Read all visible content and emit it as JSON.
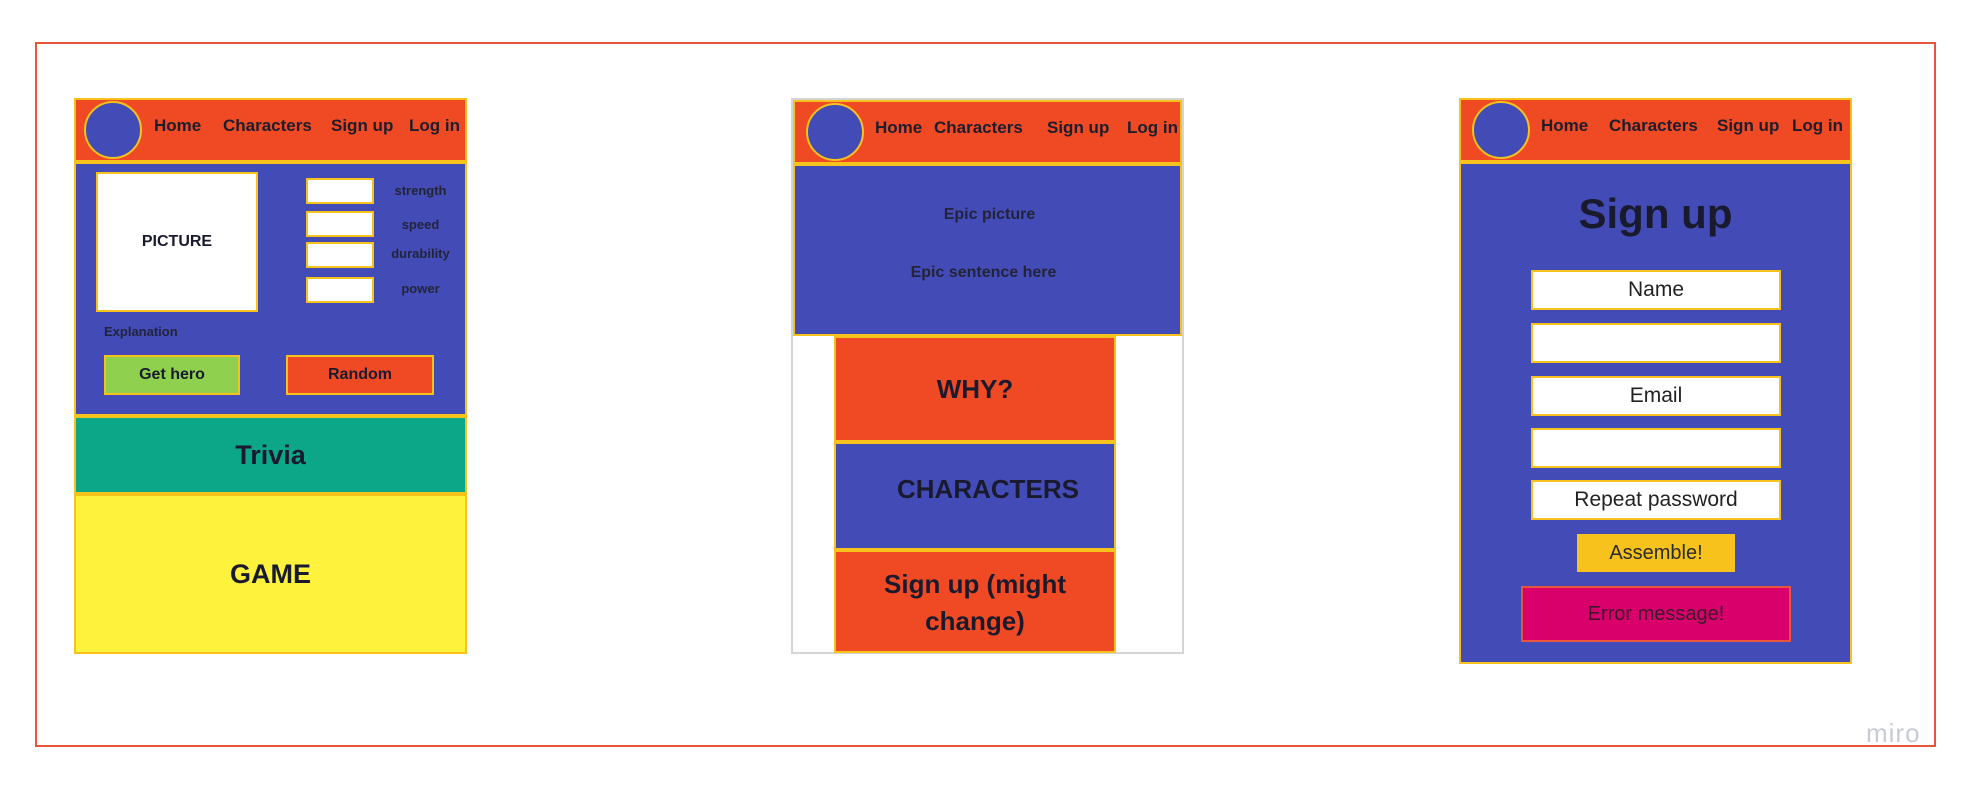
{
  "nav": {
    "home": "Home",
    "characters": "Characters",
    "signup": "Sign up",
    "login": "Log in"
  },
  "hero_page": {
    "picture": "PICTURE",
    "stats": [
      "strength",
      "speed",
      "durability",
      "power"
    ],
    "explanation": "Explanation",
    "get_hero": "Get hero",
    "random": "Random",
    "trivia": "Trivia",
    "game": "GAME"
  },
  "home_page": {
    "epic_picture": "Epic picture",
    "epic_sentence": "Epic sentence here",
    "why": "WHY?",
    "characters": "CHARACTERS",
    "signup_line1": "Sign up (might",
    "signup_line2": "change)"
  },
  "signup_page": {
    "title": "Sign up",
    "name_placeholder": "Name",
    "field2": "",
    "email_placeholder": "Email",
    "field4": "",
    "repeat_password": "Repeat password",
    "assemble": "Assemble!",
    "error": "Error message!"
  },
  "brand": "miro",
  "colors": {
    "orange": "#f04a25",
    "blue": "#434cb6",
    "yellow_border": "#f6c21c",
    "green_button": "#8fd14f",
    "trivia_green": "#0ca789",
    "game_yellow": "#fef23d",
    "assemble_yellow": "#f8c21c",
    "error_pink": "#d9006c"
  }
}
